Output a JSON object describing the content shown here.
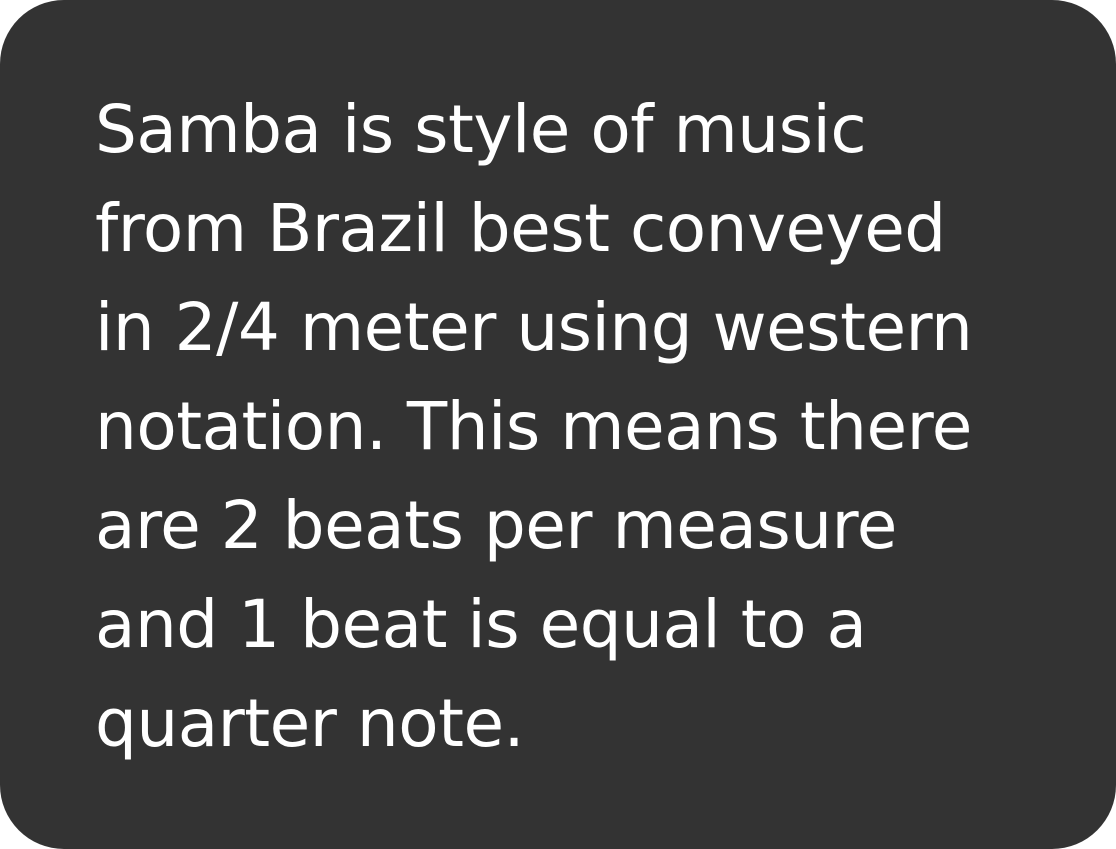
{
  "card": {
    "background": "#333333",
    "text_color": "#ffffff",
    "lines": [
      "Samba is style of music",
      "from Brazil best conveyed",
      "in 2/4 meter using western",
      "notation. This means there",
      "are 2 beats per measure",
      "and 1 beat is equal to a",
      "quarter note."
    ]
  }
}
